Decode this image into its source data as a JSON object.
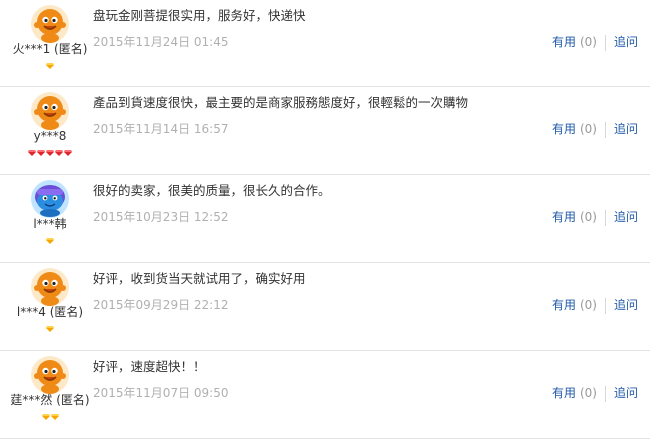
{
  "reviews": [
    {
      "username": "火***1 (匿名)",
      "avatar_icon": "orange-mascot-avatar-icon",
      "level_icon": "gold-gem-icon",
      "level_count": 1,
      "comment": "盘玩金刚菩提很实用，服务好，快递快",
      "date": "2015年11月24日 01:45",
      "useful_label": "有用",
      "useful_count": "(0)",
      "ask_label": "追问"
    },
    {
      "username": "y***8",
      "avatar_icon": "orange-mascot-avatar-icon",
      "level_icon": "red-diamond-icon",
      "level_count": 5,
      "comment": "產品到貨速度很快，最主要的是商家服務態度好，很輕鬆的一次購物",
      "date": "2015年11月14日 16:57",
      "useful_label": "有用",
      "useful_count": "(0)",
      "ask_label": "追问"
    },
    {
      "username": "l***韩",
      "avatar_icon": "blue-cartoon-avatar-icon",
      "level_icon": "gold-gem-icon",
      "level_count": 1,
      "comment": "很好的卖家，很美的质量，很长久的合作。",
      "date": "2015年10月23日 12:52",
      "useful_label": "有用",
      "useful_count": "(0)",
      "ask_label": "追问"
    },
    {
      "username": "l***4 (匿名)",
      "avatar_icon": "orange-mascot-avatar-icon",
      "level_icon": "gold-gem-icon",
      "level_count": 1,
      "comment": "好评，收到货当天就试用了，确实好用",
      "date": "2015年09月29日 22:12",
      "useful_label": "有用",
      "useful_count": "(0)",
      "ask_label": "追问"
    },
    {
      "username": "莛***然 (匿名)",
      "avatar_icon": "orange-mascot-avatar-icon",
      "level_icon": "gold-gem-icon",
      "level_count": 2,
      "comment": "好评，速度超快！！",
      "date": "2015年11月07日 09:50",
      "useful_label": "有用",
      "useful_count": "(0)",
      "ask_label": "追问"
    }
  ],
  "colors": {
    "link": "#1f5aa8",
    "date": "#b0b0b0",
    "divider": "#e3e3e3",
    "gold_gem": "#f5a800",
    "red_diamond": "#e0262d",
    "mascot_orange": "#f08a16"
  }
}
